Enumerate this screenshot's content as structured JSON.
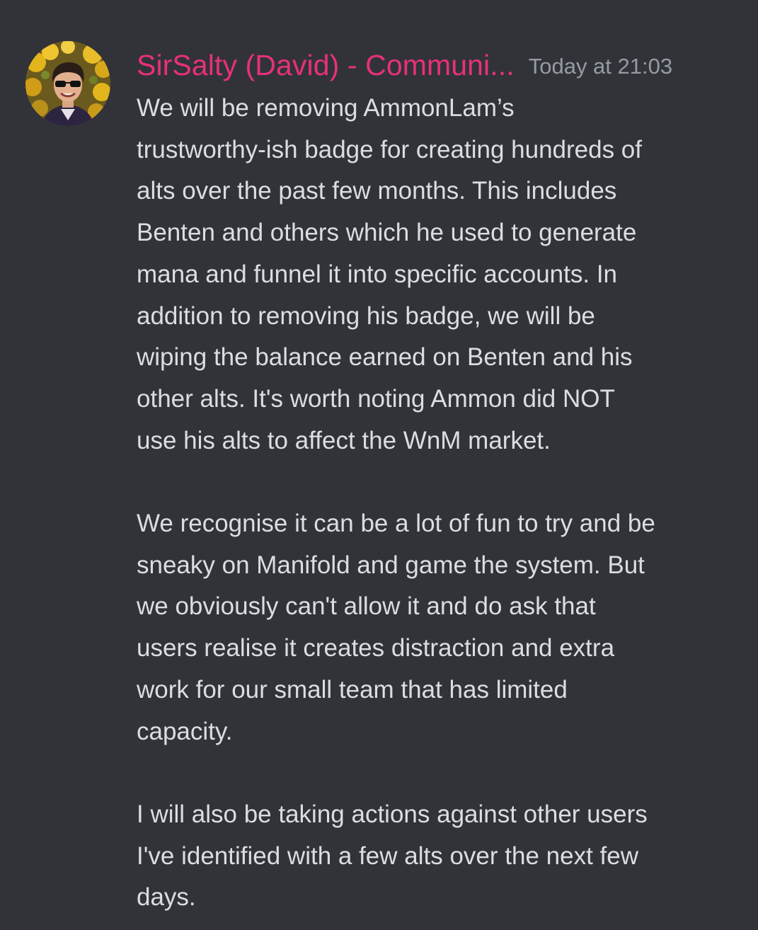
{
  "message": {
    "author": "SirSalty (David) - Communi...",
    "timestamp": "Today at 21:03",
    "paragraphs": [
      [
        "We will be removing AmmonLam’s",
        "trustworthy-ish badge for creating hundreds of",
        "alts over the past few months. This includes",
        "Benten and others which he used to generate",
        "mana and funnel it into specific accounts. In",
        "addition to removing his badge, we will be",
        "wiping the balance earned on Benten and his",
        "other alts. It's worth noting Ammon did NOT",
        "use his alts to affect the WnM market."
      ],
      [
        "We recognise it can be a lot of fun to try and be",
        "sneaky on Manifold and game the system. But",
        "we obviously can't allow it and do ask that",
        "users realise it creates distraction and extra",
        "work for our small team that has limited",
        "capacity."
      ],
      [
        "I will also be taking actions against other users",
        "I've identified with a few alts over the next few",
        "days."
      ]
    ]
  },
  "colors": {
    "background": "#313338",
    "author": "#e8307a",
    "timestamp": "#949ba4",
    "text": "#dbdee1"
  }
}
